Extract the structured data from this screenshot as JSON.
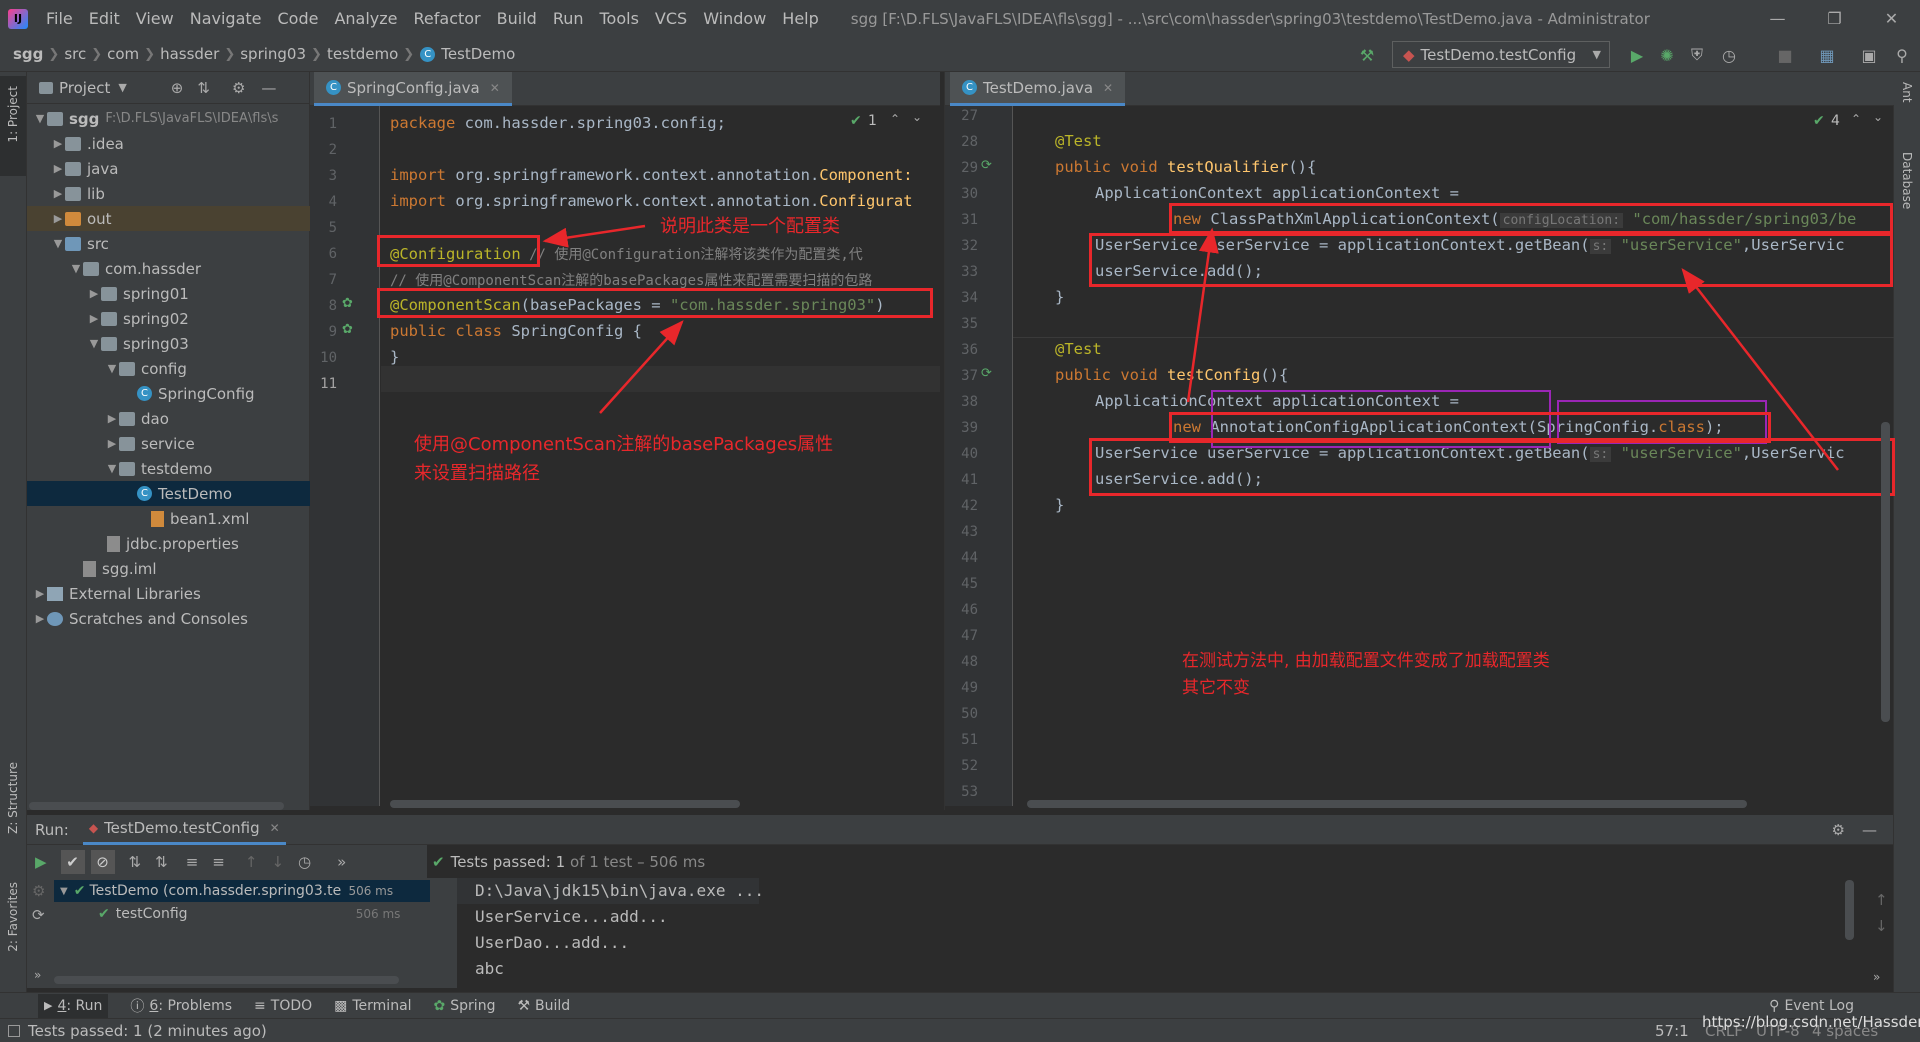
{
  "menu": [
    "File",
    "Edit",
    "View",
    "Navigate",
    "Code",
    "Analyze",
    "Refactor",
    "Build",
    "Run",
    "Tools",
    "VCS",
    "Window",
    "Help"
  ],
  "window_title": "sgg [F:\\D.FLS\\JavaFLS\\IDEA\\fls\\sgg] - ...\\src\\com\\hassder\\spring03\\testdemo\\TestDemo.java - Administrator",
  "breadcrumb": [
    "sgg",
    "src",
    "com",
    "hassder",
    "spring03",
    "testdemo",
    "TestDemo"
  ],
  "run_config": "TestDemo.testConfig",
  "left_strip": {
    "project": "1: Project",
    "structure": "Z: Structure",
    "favorites": "2: Favorites"
  },
  "right_strip": {
    "ant": "Ant",
    "database": "Database"
  },
  "project_panel": {
    "title": "Project",
    "tree": [
      {
        "label": "sgg",
        "extra": "F:\\D.FLS\\JavaFLS\\IDEA\\fls\\s"
      },
      {
        "label": ".idea"
      },
      {
        "label": "java"
      },
      {
        "label": "lib"
      },
      {
        "label": "out"
      },
      {
        "label": "src"
      },
      {
        "label": "com.hassder"
      },
      {
        "label": "spring01"
      },
      {
        "label": "spring02"
      },
      {
        "label": "spring03"
      },
      {
        "label": "config"
      },
      {
        "label": "SpringConfig"
      },
      {
        "label": "dao"
      },
      {
        "label": "service"
      },
      {
        "label": "testdemo"
      },
      {
        "label": "TestDemo"
      },
      {
        "label": "bean1.xml"
      },
      {
        "label": "jdbc.properties"
      },
      {
        "label": "sgg.iml"
      },
      {
        "label": "External Libraries"
      },
      {
        "label": "Scratches and Consoles"
      }
    ]
  },
  "editor_left": {
    "tab": "SpringConfig.java",
    "inspection": "1",
    "line_numbers": [
      "1",
      "2",
      "3",
      "4",
      "5",
      "6",
      "7",
      "8",
      "9",
      "10",
      "11"
    ],
    "lines": {
      "l1_kw": "package",
      "l1_rest": " com.hassder.spring03.config;",
      "l3_kw": "import",
      "l3_rest": " org.springframework.context.annotation.",
      "l3_cls": "Component:",
      "l4_kw": "import",
      "l4_rest": " org.springframework.context.annotation.",
      "l4_cls": "Configurat",
      "l6_an": "@Configuration",
      "l6_cm": " // 使用@Configuration注解将该类作为配置类,代",
      "l7_cm": "// 使用@ComponentScan注解的basePackages属性来配置需要扫描的包路",
      "l8_an": "@ComponentScan",
      "l8_mid": "(basePackages = ",
      "l8_str": "\"com.hassder.spring03\"",
      "l8_end": ")",
      "l9_kw": "public class",
      "l9_rest": " SpringConfig {",
      "l10": "}"
    },
    "note1": "说明此类是一个配置类",
    "note2_line1": "使用@ComponentScan注解的basePackages属性",
    "note2_line2": "来设置扫描路径"
  },
  "editor_right": {
    "tab": "TestDemo.java",
    "inspection": "4",
    "line_numbers": [
      "27",
      "28",
      "29",
      "30",
      "31",
      "32",
      "33",
      "34",
      "35",
      "36",
      "37",
      "38",
      "39",
      "40",
      "41",
      "42",
      "43",
      "44",
      "45",
      "46",
      "47",
      "48",
      "49",
      "50",
      "51",
      "52",
      "53"
    ],
    "lines": {
      "test": "@Test",
      "pv": "public void",
      "m1": "testQualifier",
      "m2": "testConfig",
      "paren": "(){",
      "ac": "ApplicationContext applicationContext =",
      "new": "new",
      "cpx": " ClassPathXmlApplicationContext(",
      "hint_cfg": "configLocation:",
      "cpx_str": "\"com/hassder/spring03/be",
      "us": "UserService userService = applicationContext.getBean(",
      "hint_s": "s:",
      "us_str": "\"userService\"",
      "us_end": ",UserServic",
      "add": "userService.add();",
      "close": "}",
      "acc": " AnnotationConfigApplicationContext(",
      "acc_cls": "SpringConfig.",
      "acc_kw": "class",
      "acc_end": ");"
    },
    "note_line1": "在测试方法中, 由加载配置文件变成了加载配置类",
    "note_line2": "其它不变"
  },
  "run_panel": {
    "label": "Run:",
    "tab": "TestDemo.testConfig",
    "status_prefix": "Tests passed:",
    "status_count": "1",
    "status_suffix": "of 1 test – 506 ms",
    "tree": [
      {
        "label": "TestDemo (com.hassder.spring03.te",
        "time": "506 ms"
      },
      {
        "label": "testConfig",
        "time": "506 ms"
      }
    ],
    "console": [
      "D:\\Java\\jdk15\\bin\\java.exe ...",
      "UserService...add...",
      "UserDao...add...",
      "abc"
    ]
  },
  "bottom_tabs": [
    {
      "key": "4",
      "label": ": Run"
    },
    {
      "key": "6",
      "label": ": Problems"
    },
    {
      "key": "",
      "label": "TODO"
    },
    {
      "key": "",
      "label": "Terminal"
    },
    {
      "key": "",
      "label": "Spring"
    },
    {
      "key": "",
      "label": "Build"
    }
  ],
  "event_log": "Event Log",
  "status_bar": {
    "message": "Tests passed: 1 (2 minutes ago)",
    "position": "57:1",
    "line_sep": "CRLF",
    "encoding": "UTF-8",
    "indent": "4 spaces",
    "watermark": "https://blog.csdn.net/Hassder"
  }
}
